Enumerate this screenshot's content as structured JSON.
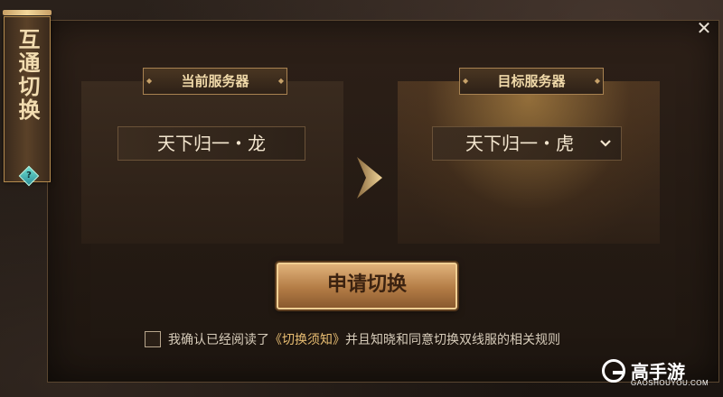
{
  "side_title": "互通切换",
  "help_icon_glyph": "?",
  "close_glyph": "✕",
  "current_server": {
    "label": "当前服务器",
    "value": "天下归一・龙"
  },
  "target_server": {
    "label": "目标服务器",
    "value": "天下归一・虎",
    "dropdown_icon": "chevron-down-icon"
  },
  "apply_button_label": "申请切换",
  "agreement": {
    "checked": false,
    "prefix": "我确认已经阅读了",
    "link": "《切换须知》",
    "suffix": "并且知晓和同意切换双线服的相关规则"
  },
  "watermark": {
    "text": "高手游",
    "sub": "GAOSHOUYOU.COM"
  },
  "colors": {
    "accent_gold": "#e8bd72",
    "button_top": "#e0b27a",
    "button_bottom": "#8a5a2f"
  }
}
